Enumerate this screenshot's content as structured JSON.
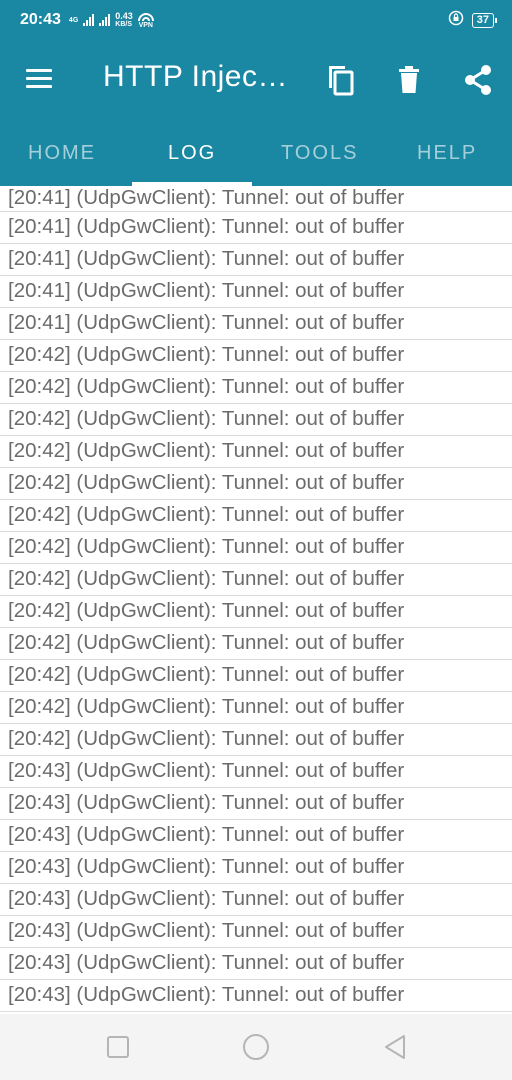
{
  "status_bar": {
    "time": "20:43",
    "net_type_a": "4G",
    "net_speed_value": "0.43",
    "net_speed_unit": "KB/S",
    "vpn": "VPN",
    "battery": "37"
  },
  "app_bar": {
    "title": "HTTP Injec…",
    "icons": [
      "menu-icon",
      "copy-icon",
      "trash-icon",
      "share-icon"
    ]
  },
  "tabs": [
    {
      "label": "HOME",
      "active": false
    },
    {
      "label": "LOG",
      "active": true
    },
    {
      "label": "TOOLS",
      "active": false
    },
    {
      "label": "HELP",
      "active": false
    }
  ],
  "log_entries": [
    "[20:41] (UdpGwClient): Tunnel: out of buffer",
    "[20:41] (UdpGwClient): Tunnel: out of buffer",
    "[20:41] (UdpGwClient): Tunnel: out of buffer",
    "[20:41] (UdpGwClient): Tunnel: out of buffer",
    "[20:41] (UdpGwClient): Tunnel: out of buffer",
    "[20:42] (UdpGwClient): Tunnel: out of buffer",
    "[20:42] (UdpGwClient): Tunnel: out of buffer",
    "[20:42] (UdpGwClient): Tunnel: out of buffer",
    "[20:42] (UdpGwClient): Tunnel: out of buffer",
    "[20:42] (UdpGwClient): Tunnel: out of buffer",
    "[20:42] (UdpGwClient): Tunnel: out of buffer",
    "[20:42] (UdpGwClient): Tunnel: out of buffer",
    "[20:42] (UdpGwClient): Tunnel: out of buffer",
    "[20:42] (UdpGwClient): Tunnel: out of buffer",
    "[20:42] (UdpGwClient): Tunnel: out of buffer",
    "[20:42] (UdpGwClient): Tunnel: out of buffer",
    "[20:42] (UdpGwClient): Tunnel: out of buffer",
    "[20:42] (UdpGwClient): Tunnel: out of buffer",
    "[20:43] (UdpGwClient): Tunnel: out of buffer",
    "[20:43] (UdpGwClient): Tunnel: out of buffer",
    "[20:43] (UdpGwClient): Tunnel: out of buffer",
    "[20:43] (UdpGwClient): Tunnel: out of buffer",
    "[20:43] (UdpGwClient): Tunnel: out of buffer",
    "[20:43] (UdpGwClient): Tunnel: out of buffer",
    "[20:43] (UdpGwClient): Tunnel: out of buffer",
    "[20:43] (UdpGwClient): Tunnel: out of buffer"
  ],
  "nav_bar": {
    "icons": [
      "recents-square-icon",
      "home-circle-icon",
      "back-triangle-icon"
    ]
  },
  "colors": {
    "primary": "#1b88a3",
    "log_text": "#6b6b6b",
    "divider": "#dcdcdc"
  }
}
